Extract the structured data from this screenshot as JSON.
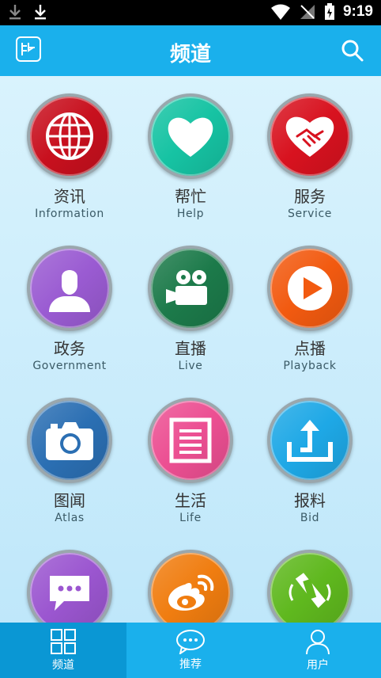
{
  "status": {
    "time": "9:19"
  },
  "header": {
    "title": "频道"
  },
  "channels": [
    {
      "name": "资讯",
      "sub": "Information",
      "color": "#c8101e",
      "icon": "globe-icon"
    },
    {
      "name": "帮忙",
      "sub": "Help",
      "color": "#16c3a3",
      "icon": "heart-icon"
    },
    {
      "name": "服务",
      "sub": "Service",
      "color": "#d8121f",
      "icon": "handshake-icon"
    },
    {
      "name": "政务",
      "sub": "Government",
      "color": "#9a5bd2",
      "icon": "person-icon"
    },
    {
      "name": "直播",
      "sub": "Live",
      "color": "#1c7a4a",
      "icon": "video-camera-icon"
    },
    {
      "name": "点播",
      "sub": "Playback",
      "color": "#f25a10",
      "icon": "play-icon"
    },
    {
      "name": "图闻",
      "sub": "Atlas",
      "color": "#2b6fb3",
      "icon": "camera-icon"
    },
    {
      "name": "生活",
      "sub": "Life",
      "color": "#ec4f92",
      "icon": "document-icon"
    },
    {
      "name": "报料",
      "sub": "Bid",
      "color": "#1ea8e6",
      "icon": "upload-icon"
    },
    {
      "name": "",
      "sub": "",
      "color": "#9b56d0",
      "icon": "chat-icon"
    },
    {
      "name": "",
      "sub": "",
      "color": "#f07d10",
      "icon": "weibo-icon"
    },
    {
      "name": "",
      "sub": "",
      "color": "#5fb81e",
      "icon": "phone-icon"
    }
  ],
  "nav": [
    {
      "label": "频道",
      "icon": "grid-icon",
      "active": true
    },
    {
      "label": "推荐",
      "icon": "chat-bubble-icon",
      "active": false
    },
    {
      "label": "用户",
      "icon": "user-icon",
      "active": false
    }
  ]
}
